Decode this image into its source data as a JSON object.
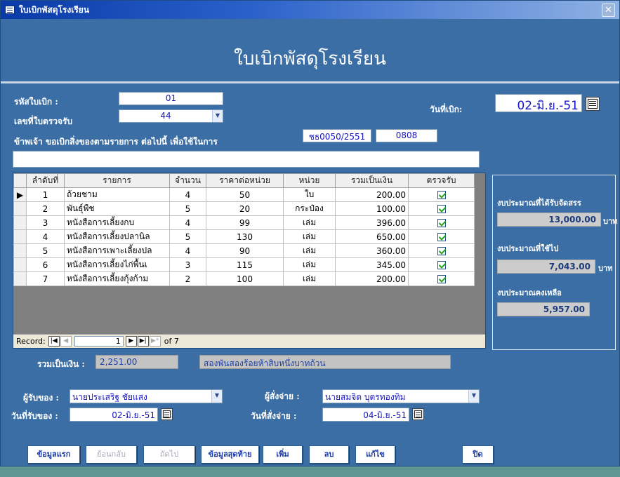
{
  "window": {
    "title": "ใบเบิกพัสดุโรงเรียน",
    "close_glyph": "✕"
  },
  "form": {
    "heading": "ใบเบิกพัสดุโรงเรียน",
    "requisition_code_label": "รหัสใบเบิก :",
    "requisition_code_value": "01",
    "receipt_no_label": "เลขที่ใบตรวจรับ",
    "receipt_no_value": "44",
    "statement_label": "ข้าพเจ้า ขอเบิกสิ่งของตามรายการ ต่อไปนี้ เพื่อใช้ในการ",
    "doc_no": "ชธ0050/2551",
    "doc_no_2": "0808",
    "purpose_value": "",
    "request_date_label": "วันที่เบิก:",
    "request_date_value": "02-มิ.ย.-51"
  },
  "grid": {
    "columns": [
      "ลำดับที่",
      "รายการ",
      "จำนวน",
      "ราคาต่อหน่วย",
      "หน่วย",
      "รวมเป็นเงิน",
      "ตรวจรับ"
    ],
    "rows": [
      {
        "no": "1",
        "item": "ถ้วยชาม",
        "qty": "4",
        "price": "50",
        "unit": "ใบ",
        "total": "200.00",
        "checked": true
      },
      {
        "no": "2",
        "item": "พันธุ์พืช",
        "qty": "5",
        "price": "20",
        "unit": "กระป๋อง",
        "total": "100.00",
        "checked": true
      },
      {
        "no": "3",
        "item": "หนังสือการเลี้ยงกบ",
        "qty": "4",
        "price": "99",
        "unit": "เล่ม",
        "total": "396.00",
        "checked": true
      },
      {
        "no": "4",
        "item": "หนังสือการเลี้ยงปลานิล",
        "qty": "5",
        "price": "130",
        "unit": "เล่ม",
        "total": "650.00",
        "checked": true
      },
      {
        "no": "5",
        "item": "หนังสือการเพาะเลี้ยงปล",
        "qty": "4",
        "price": "90",
        "unit": "เล่ม",
        "total": "360.00",
        "checked": true
      },
      {
        "no": "6",
        "item": "หนังสือการเลี้ยงไก่พื้นเ",
        "qty": "3",
        "price": "115",
        "unit": "เล่ม",
        "total": "345.00",
        "checked": true
      },
      {
        "no": "7",
        "item": "หนังสือการเลี้ยงกุ้งก้าม",
        "qty": "2",
        "price": "100",
        "unit": "เล่ม",
        "total": "200.00",
        "checked": true
      }
    ],
    "record_label": "Record:",
    "record_position": "1",
    "record_total": "of 7"
  },
  "budget": {
    "allocated_label": "งบประมาณที่ได้รับจัดสรร",
    "allocated_value": "13,000.00",
    "used_label": "งบประมาณที่ใช้ไป",
    "used_value": "7,043.00",
    "remaining_label": "งบประมาณคงเหลือ",
    "remaining_value": "5,957.00",
    "unit": "บาท"
  },
  "totals": {
    "label": "รวมเป็นเงิน :",
    "value": "2,251.00",
    "text": "สองพันสองร้อยห้าสิบหนึ่งบาทถ้วน"
  },
  "people": {
    "receiver_label": "ผู้รับของ :",
    "receiver_value": "นายประเสริฐ ชัยแสง",
    "receive_date_label": "วันที่รับของ :",
    "receive_date_value": "02-มิ.ย.-51",
    "approver_label": "ผู้สั่งจ่าย :",
    "approver_value": "นายสมจิต บุตรทองทิม",
    "approve_date_label": "วันที่สั่งจ่าย :",
    "approve_date_value": "04-มิ.ย.-51"
  },
  "buttons": {
    "first": "ข้อมูลแรก",
    "prev": "ย้อนกลับ",
    "next": "ถัดไป",
    "last": "ข้อมูลสุดท้าย",
    "add": "เพิ่ม",
    "delete": "ลบ",
    "edit": "แก้ไข",
    "close": "ปิด"
  }
}
